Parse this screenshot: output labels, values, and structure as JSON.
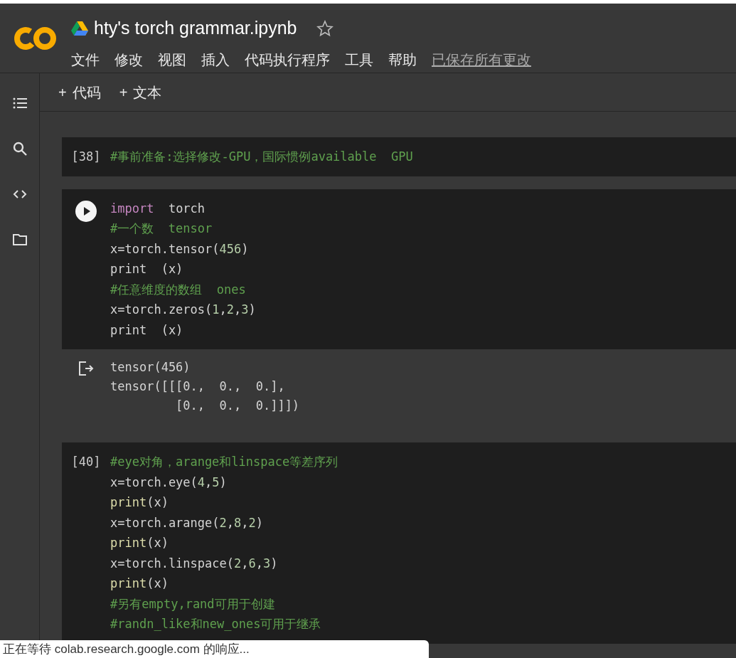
{
  "header": {
    "title": "hty's torch grammar.ipynb",
    "menu": [
      "文件",
      "修改",
      "视图",
      "插入",
      "代码执行程序",
      "工具",
      "帮助"
    ],
    "save_status": "已保存所有更改"
  },
  "toolbar": [
    {
      "label": "代码",
      "symbol": "+"
    },
    {
      "label": "文本",
      "symbol": "+"
    }
  ],
  "cells": [
    {
      "prompt": "[38]",
      "run_button": false,
      "lines": [
        [
          {
            "text": "#事前准备:选择修改-GPU，国际惯例available  GPU",
            "kind": "comment"
          }
        ]
      ]
    },
    {
      "run_button": true,
      "lines": [
        [
          {
            "text": "import",
            "kind": "keyword"
          },
          {
            "text": "  torch",
            "kind": "plain"
          }
        ],
        [
          {
            "text": "#一个数  tensor",
            "kind": "comment"
          }
        ],
        [
          {
            "text": "x=torch.tensor(",
            "kind": "plain"
          },
          {
            "text": "456",
            "kind": "number"
          },
          {
            "text": ")",
            "kind": "plain"
          }
        ],
        [
          {
            "text": "print  (x)",
            "kind": "plain"
          }
        ],
        [
          {
            "text": "#任意维度的数组  ones",
            "kind": "comment"
          }
        ],
        [
          {
            "text": "x=torch.zeros(",
            "kind": "plain"
          },
          {
            "text": "1",
            "kind": "number"
          },
          {
            "text": ",",
            "kind": "plain"
          },
          {
            "text": "2",
            "kind": "number"
          },
          {
            "text": ",",
            "kind": "plain"
          },
          {
            "text": "3",
            "kind": "number"
          },
          {
            "text": ")",
            "kind": "plain"
          }
        ],
        [
          {
            "text": "print  (x)",
            "kind": "plain"
          }
        ]
      ],
      "output": [
        "tensor(456)",
        "tensor([[[0.,  0.,  0.],",
        "         [0.,  0.,  0.]]])"
      ]
    },
    {
      "prompt": "[40]",
      "run_button": false,
      "lines": [
        [
          {
            "text": "#eye对角，arange和linspace等差序列",
            "kind": "comment"
          }
        ],
        [
          {
            "text": "x=torch.eye(",
            "kind": "plain"
          },
          {
            "text": "4",
            "kind": "number"
          },
          {
            "text": ",",
            "kind": "plain"
          },
          {
            "text": "5",
            "kind": "number"
          },
          {
            "text": ")",
            "kind": "plain"
          }
        ],
        [
          {
            "text": "print",
            "kind": "builtin"
          },
          {
            "text": "(x)",
            "kind": "plain"
          }
        ],
        [
          {
            "text": "x=torch.arange(",
            "kind": "plain"
          },
          {
            "text": "2",
            "kind": "number"
          },
          {
            "text": ",",
            "kind": "plain"
          },
          {
            "text": "8",
            "kind": "number"
          },
          {
            "text": ",",
            "kind": "plain"
          },
          {
            "text": "2",
            "kind": "number"
          },
          {
            "text": ")",
            "kind": "plain"
          }
        ],
        [
          {
            "text": "print",
            "kind": "builtin"
          },
          {
            "text": "(x)",
            "kind": "plain"
          }
        ],
        [
          {
            "text": "x=torch.linspace(",
            "kind": "plain"
          },
          {
            "text": "2",
            "kind": "number"
          },
          {
            "text": ",",
            "kind": "plain"
          },
          {
            "text": "6",
            "kind": "number"
          },
          {
            "text": ",",
            "kind": "plain"
          },
          {
            "text": "3",
            "kind": "number"
          },
          {
            "text": ")",
            "kind": "plain"
          }
        ],
        [
          {
            "text": "print",
            "kind": "builtin"
          },
          {
            "text": "(x)",
            "kind": "plain"
          }
        ],
        [
          {
            "text": "#另有empty,rand可用于创建",
            "kind": "comment"
          }
        ],
        [
          {
            "text": "#randn_like和new_ones可用于继承",
            "kind": "comment"
          }
        ]
      ]
    }
  ],
  "status_bar": "正在等待 colab.research.google.com 的响应..."
}
